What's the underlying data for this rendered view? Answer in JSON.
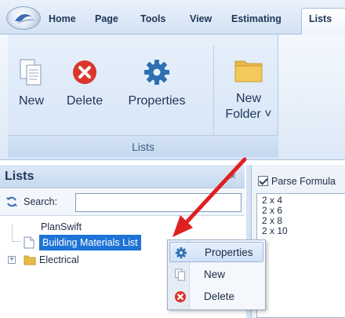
{
  "ribbon": {
    "tabs": [
      "Home",
      "Page",
      "Tools",
      "View",
      "Estimating"
    ],
    "active_tab": "Lists",
    "group_label": "Lists",
    "buttons": {
      "new": "New",
      "delete": "Delete",
      "properties": "Properties",
      "new_folder_line1": "New",
      "new_folder_line2": "Folder ˅"
    }
  },
  "lists_panel": {
    "title": "Lists",
    "close_glyph": "×",
    "search_label": "Search:",
    "search_value": "",
    "tree": {
      "root": "PlanSwift",
      "items": [
        {
          "label": "Building Materials List",
          "selected": true
        },
        {
          "label": "Electrical",
          "expander": "+"
        }
      ]
    }
  },
  "right_panel": {
    "parse_formula_label": "Parse Formula",
    "parse_formula_checked": true,
    "formula_lines": [
      "2 x 4",
      "2 x 6",
      "2 x 8",
      "2 x 10"
    ]
  },
  "context_menu": {
    "items": [
      {
        "label": "Properties",
        "icon": "gear-icon",
        "highlighted": true
      },
      {
        "label": "New",
        "icon": "new-document-icon"
      },
      {
        "label": "Delete",
        "icon": "delete-icon"
      }
    ]
  },
  "colors": {
    "accent_red": "#d9372c",
    "gear_blue": "#2f6fb3",
    "folder_yellow": "#e9b949",
    "selection_blue": "#1e73d6",
    "annotation_arrow": "#e02020"
  }
}
